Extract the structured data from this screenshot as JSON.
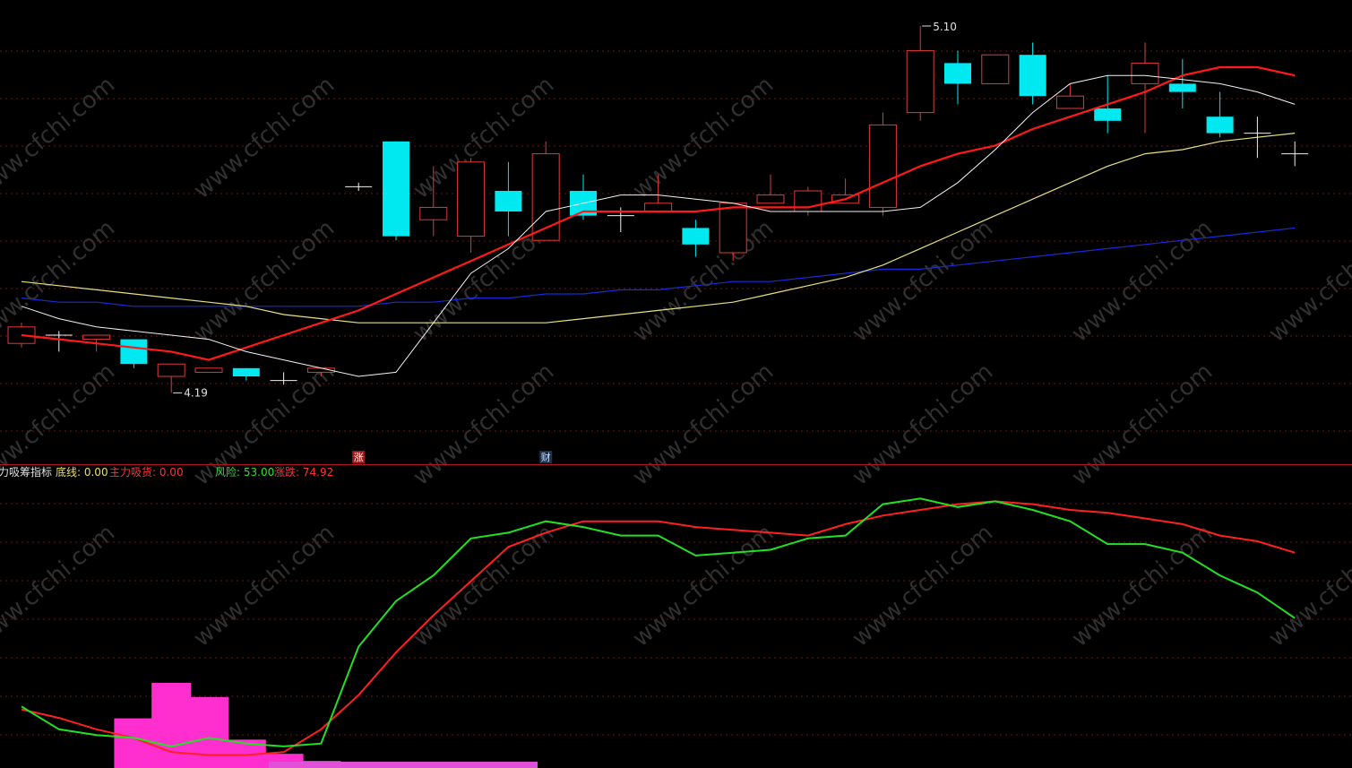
{
  "colors": {
    "background": "#000000",
    "grid": "#7a1010",
    "divider": "#b01818",
    "bull": "#e03a3a",
    "bear": "#00e8f0",
    "doji": "#f0f0f0",
    "ma5": "#f2f2f2",
    "ma10": "#ff1a1a",
    "ma30": "#e8e080",
    "ma60": "#1a2ad8",
    "green": "#22e022",
    "red": "#ff2020",
    "watermark": "#303030",
    "label_yellow": "#e8e060",
    "label_red": "#ff3030",
    "label_green": "#33dd33",
    "label_white": "#e0e0e0"
  },
  "watermark_text": "www.cfchi.com",
  "chart_data": [
    {
      "type": "candlestick",
      "name": "price",
      "annotations": {
        "high_label": "5.10",
        "low_label": "4.19"
      },
      "markers": [
        {
          "text": "涨",
          "index": 9,
          "bg": "#a01818",
          "fg": "#ffffff"
        },
        {
          "text": "财",
          "index": 14,
          "bg": "#20304a",
          "fg": "#bfe0ff"
        }
      ],
      "ohlc": [
        [
          4.33,
          4.37,
          4.32,
          4.38
        ],
        [
          4.35,
          4.35,
          4.31,
          4.36
        ],
        [
          4.34,
          4.35,
          4.31,
          4.35
        ],
        [
          4.34,
          4.28,
          4.27,
          4.34
        ],
        [
          4.25,
          4.28,
          4.21,
          4.28
        ],
        [
          4.26,
          4.27,
          4.26,
          4.27
        ],
        [
          4.27,
          4.25,
          4.24,
          4.27
        ],
        [
          4.24,
          4.24,
          4.23,
          4.26
        ],
        [
          4.26,
          4.27,
          4.25,
          4.27
        ],
        [
          4.71,
          4.71,
          4.7,
          4.72
        ],
        [
          4.82,
          4.59,
          4.58,
          4.82
        ],
        [
          4.63,
          4.66,
          4.59,
          4.76
        ],
        [
          4.59,
          4.77,
          4.55,
          4.78
        ],
        [
          4.7,
          4.65,
          4.59,
          4.77
        ],
        [
          4.58,
          4.79,
          4.58,
          4.82
        ],
        [
          4.7,
          4.64,
          4.63,
          4.74
        ],
        [
          4.64,
          4.64,
          4.6,
          4.66
        ],
        [
          4.65,
          4.67,
          4.65,
          4.74
        ],
        [
          4.61,
          4.57,
          4.54,
          4.63
        ],
        [
          4.55,
          4.67,
          4.53,
          4.67
        ],
        [
          4.67,
          4.69,
          4.67,
          4.74
        ],
        [
          4.65,
          4.7,
          4.64,
          4.71
        ],
        [
          4.67,
          4.69,
          4.67,
          4.73
        ],
        [
          4.66,
          4.86,
          4.64,
          4.89
        ],
        [
          4.89,
          5.04,
          4.87,
          5.1
        ],
        [
          5.01,
          4.96,
          4.91,
          5.04
        ],
        [
          4.96,
          5.03,
          4.96,
          5.03
        ],
        [
          5.03,
          4.93,
          4.91,
          5.06
        ],
        [
          4.9,
          4.93,
          4.91,
          4.96
        ],
        [
          4.9,
          4.87,
          4.84,
          4.98
        ],
        [
          4.96,
          5.01,
          4.84,
          5.06
        ],
        [
          4.96,
          4.94,
          4.9,
          5.02
        ],
        [
          4.88,
          4.84,
          4.83,
          4.94
        ],
        [
          4.84,
          4.84,
          4.78,
          4.88
        ],
        [
          4.79,
          4.79,
          4.76,
          4.82
        ]
      ],
      "ma5": [
        4.42,
        4.39,
        4.37,
        4.36,
        4.35,
        4.34,
        4.31,
        4.29,
        4.27,
        4.25,
        4.26,
        4.38,
        4.5,
        4.56,
        4.65,
        4.67,
        4.69,
        4.69,
        4.68,
        4.67,
        4.65,
        4.65,
        4.65,
        4.65,
        4.66,
        4.72,
        4.8,
        4.89,
        4.96,
        4.98,
        4.98,
        4.97,
        4.96,
        4.94,
        4.91
      ],
      "ma10": [
        4.43,
        4.4,
        4.38,
        4.37,
        4.35,
        4.34,
        4.33,
        4.32,
        4.31,
        4.29,
        4.32,
        4.35,
        4.38,
        4.41,
        4.45,
        4.49,
        4.53,
        4.57,
        4.61,
        4.65,
        4.65,
        4.65,
        4.65,
        4.66,
        4.66,
        4.66,
        4.68,
        4.72,
        4.76,
        4.79,
        4.81,
        4.85,
        4.88,
        4.91,
        4.94,
        4.98,
        5.0,
        5.0,
        4.98
      ],
      "ma30": [
        4.52,
        4.51,
        4.5,
        4.49,
        4.48,
        4.47,
        4.46,
        4.45,
        4.44,
        4.43,
        4.42,
        4.4,
        4.39,
        4.38,
        4.38,
        4.38,
        4.38,
        4.38,
        4.38,
        4.39,
        4.4,
        4.41,
        4.42,
        4.43,
        4.45,
        4.47,
        4.49,
        4.52,
        4.56,
        4.6,
        4.64,
        4.68,
        4.72,
        4.76,
        4.79,
        4.8,
        4.82,
        4.83,
        4.84
      ],
      "ma60": [
        4.46,
        4.45,
        4.45,
        4.44,
        4.44,
        4.43,
        4.43,
        4.42,
        4.42,
        4.42,
        4.42,
        4.42,
        4.42,
        4.42,
        4.43,
        4.43,
        4.44,
        4.44,
        4.45,
        4.45,
        4.46,
        4.46,
        4.47,
        4.48,
        4.48,
        4.49,
        4.5,
        4.51,
        4.51,
        4.52,
        4.53,
        4.54,
        4.55,
        4.56,
        4.57,
        4.58,
        4.59,
        4.6,
        4.61
      ]
    },
    {
      "type": "line",
      "name": "indicator",
      "label_prefix": "力吸筹指标",
      "legend": [
        {
          "label": "底线: 0.00",
          "color": "#e8e060"
        },
        {
          "label": "主力吸货: 0.00",
          "color": "#ff3030"
        },
        {
          "label": "风险: 53.00",
          "color": "#33dd33"
        },
        {
          "label": "涨跌: 74.92",
          "color": "#ff3030"
        }
      ],
      "ylim": [
        0,
        100
      ],
      "green": [
        20,
        12,
        10,
        9,
        6,
        9,
        7,
        6,
        7,
        41,
        57,
        66,
        79,
        81,
        85,
        83,
        80,
        80,
        73,
        74,
        75,
        79,
        80,
        91,
        93,
        90,
        92,
        89,
        85,
        77,
        77,
        74,
        66,
        60,
        51
      ],
      "red": [
        24,
        19,
        16,
        12,
        9,
        4,
        3,
        3,
        4,
        12,
        24,
        39,
        52,
        64,
        76,
        81,
        85,
        85,
        85,
        83,
        82,
        81,
        80,
        84,
        87,
        89,
        91,
        92,
        91,
        89,
        88,
        86,
        84,
        80,
        78,
        74
      ],
      "volume": [
        0,
        0,
        0,
        14,
        24,
        20,
        8,
        4,
        2,
        1,
        1,
        0,
        0,
        0,
        0,
        0,
        0,
        0,
        0,
        0,
        0,
        0,
        0,
        0,
        0,
        0,
        0,
        0,
        0,
        0,
        0,
        0,
        0,
        0,
        0
      ]
    }
  ]
}
